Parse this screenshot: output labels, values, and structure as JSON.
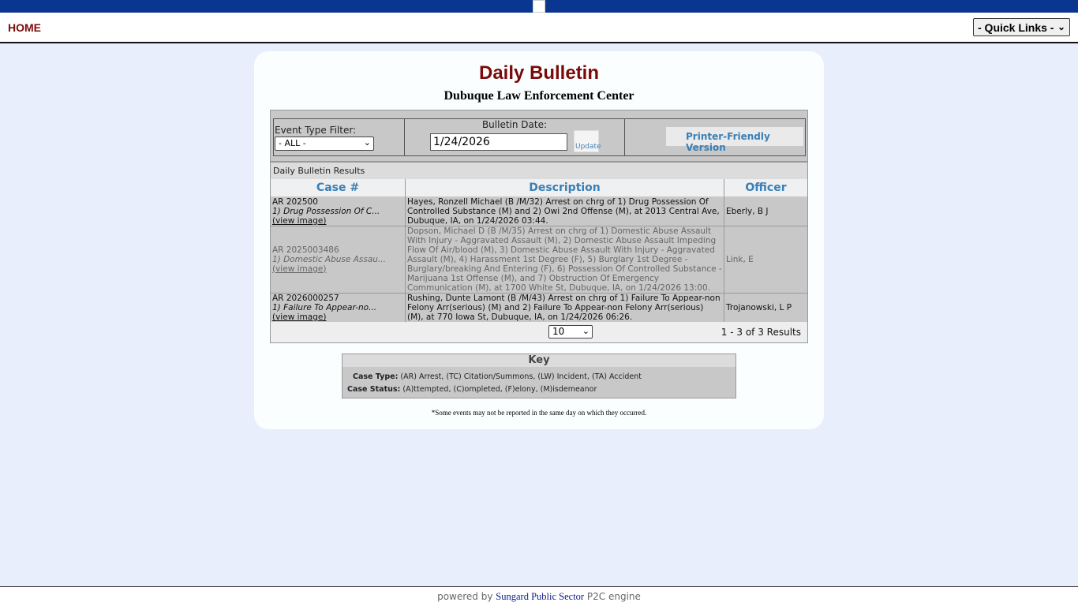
{
  "nav": {
    "home_label": "HOME",
    "quick_links_label": "- Quick Links -"
  },
  "bulletin": {
    "title": "Daily Bulletin",
    "subtitle": "Dubuque Law Enforcement Center"
  },
  "filters": {
    "event_type_label": "Event Type Filter:",
    "event_type_value": "- ALL -",
    "bulletin_date_label": "Bulletin Date:",
    "bulletin_date_value": "1/24/2026",
    "update_label": "Update",
    "printer_label": "Printer-Friendly Version"
  },
  "results": {
    "header": "Daily Bulletin Results",
    "columns": [
      "Case #",
      "Description",
      "Officer"
    ],
    "rows": [
      {
        "case_number": "AR 202500",
        "case_summary": "1) Drug Possession Of C...",
        "view_image": "(view image)",
        "description": "Hayes, Ronzell Michael (B /M/32) Arrest on chrg of 1) Drug Possession Of Controlled Substance (M) and 2) Owi 2nd Offense (M), at 2013 Central Ave, Dubuque, IA, on 1/24/2026 03:44.",
        "officer": "Eberly, B J"
      },
      {
        "case_number": "AR 2025003486",
        "case_summary": "1) Domestic Abuse Assau...",
        "view_image": "(view image)",
        "description": "Dopson, Michael D (B /M/35) Arrest on chrg of 1) Domestic Abuse Assault With Injury - Aggravated Assault (M), 2) Domestic Abuse Assault Impeding Flow Of Air/blood (M), 3) Domestic Abuse Assault With Injury - Aggravated Assault (M), 4) Harassment 1st Degree (F), 5) Burglary 1st Degree - Burglary/breaking And Entering (F), 6) Possession Of Controlled Substance - Marijuana 1st Offense (M), and 7) Obstruction Of Emergency Communication (M), at 1700 White St, Dubuque, IA, on 1/24/2026 13:00.",
        "officer": "Link, E"
      },
      {
        "case_number": "AR 2026000257",
        "case_summary": "1) Failure To Appear-no...",
        "view_image": "(view image)",
        "description": "Rushing, Dunte Lamont (B /M/43) Arrest on chrg of 1) Failure To Appear-non Felony Arr(serious) (M) and 2) Failure To Appear-non Felony Arr(serious) (M), at 770 Iowa St, Dubuque, IA, on 1/24/2026 06:26.",
        "officer": "Trojanowski, L P"
      }
    ],
    "page_size": "10",
    "count_text": "1 - 3 of 3 Results"
  },
  "key": {
    "title": "Key",
    "case_type_label": "Case Type:",
    "case_type_text": "(AR) Arrest, (TC) Citation/Summons, (LW) Incident, (TA) Accident",
    "case_status_label": "Case Status:",
    "case_status_text": "(A)ttempted, (C)ompleted, (F)elony, (M)isdemeanor"
  },
  "note": "*Some events may not be reported in the same day on which they occurred.",
  "footer": {
    "prefix": "powered by",
    "link": "Sungard Public Sector",
    "suffix": "P2C engine"
  },
  "colors": {
    "top_bar": "#0a3591",
    "title": "#7a0a0a",
    "accent_link": "#3a7fb5",
    "page_bg": "#e8eefc"
  }
}
